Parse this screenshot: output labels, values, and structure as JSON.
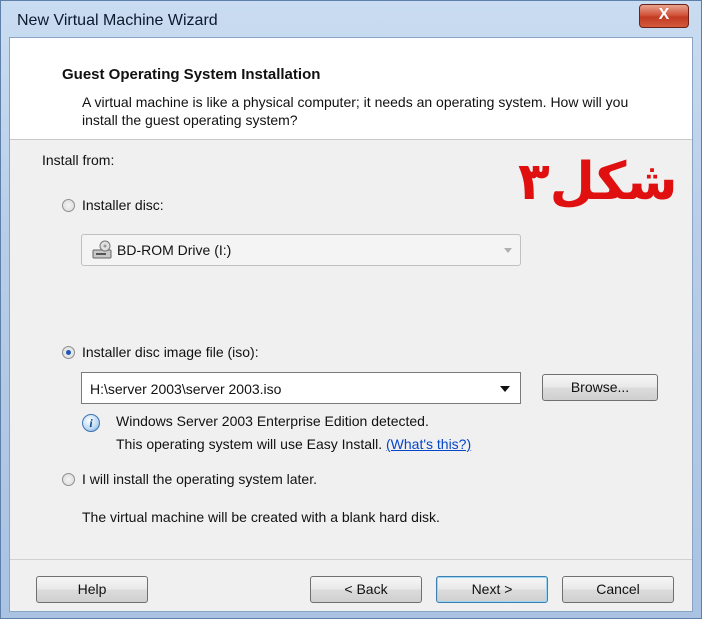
{
  "window": {
    "title": "New Virtual Machine Wizard",
    "close_label": "X"
  },
  "header": {
    "title": "Guest Operating System Installation",
    "description": "A virtual machine is like a physical computer; it needs an operating system. How will you install the guest operating system?"
  },
  "install_from_label": "Install from:",
  "overlay_label": "شکل۳",
  "options": {
    "disc": {
      "label": "Installer disc:",
      "selected": false,
      "drive": "BD-ROM Drive (I:)",
      "drive_icon": "disc-drive-icon"
    },
    "iso": {
      "label": "Installer disc image file (iso):",
      "selected": true,
      "path": "H:\\server 2003\\server 2003.iso",
      "browse_label": "Browse...",
      "info_icon": "info-icon",
      "detected_text": "Windows Server 2003 Enterprise Edition detected.",
      "easy_install_text": "This operating system will use Easy Install.",
      "whats_this": "(What's this?)"
    },
    "later": {
      "label": "I will install the operating system later.",
      "selected": false,
      "description": "The virtual machine will be created with a blank hard disk."
    }
  },
  "footer": {
    "help": "Help",
    "back": "< Back",
    "next": "Next >",
    "cancel": "Cancel"
  },
  "colors": {
    "accent": "#0645c8",
    "overlay": "#e01010",
    "close": "#c13b22"
  }
}
